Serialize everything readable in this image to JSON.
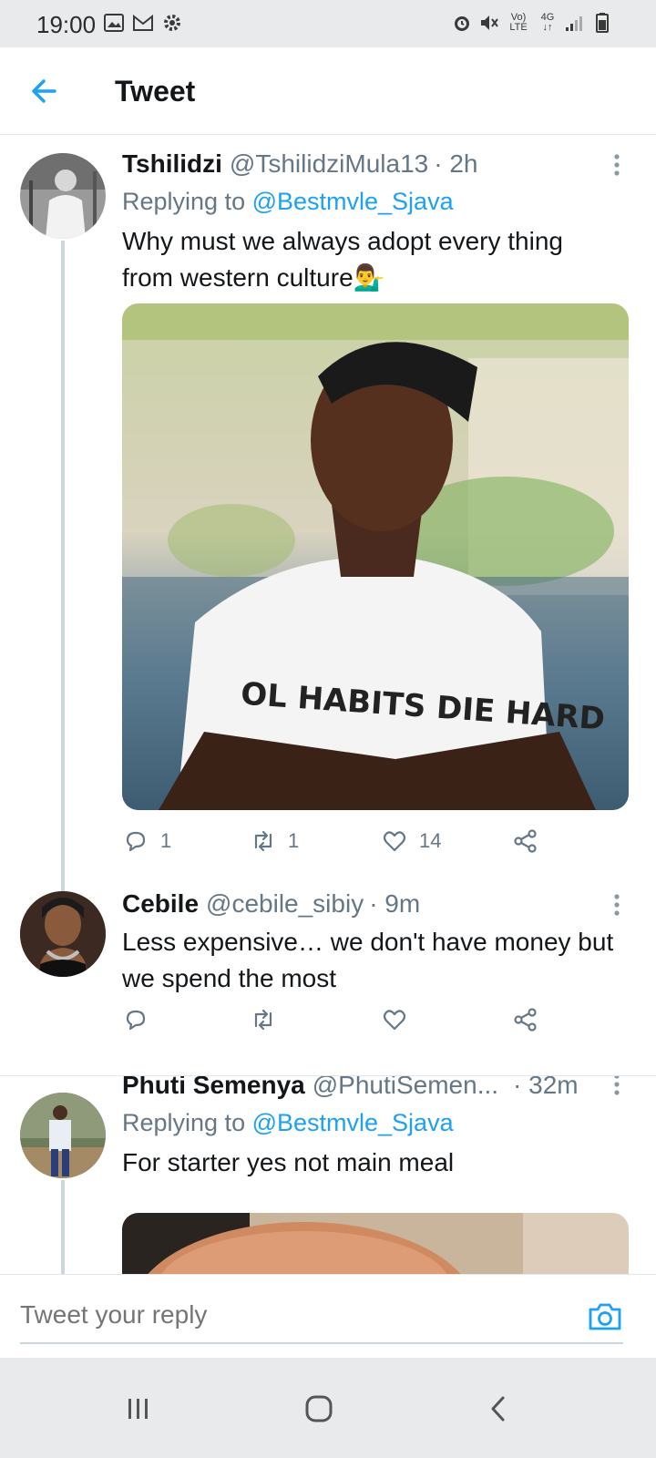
{
  "status_bar": {
    "time": "19:00",
    "left_icons": [
      "image-icon",
      "gmail-icon",
      "gear-icon"
    ],
    "right_icons": [
      "alarm-icon",
      "mute-icon",
      "volte-icon",
      "network-4g-icon",
      "signal-icon",
      "battery-icon"
    ],
    "volte_label_top": "Vo)",
    "volte_label_bottom": "LTE",
    "net_label": "4G"
  },
  "header": {
    "title": "Tweet"
  },
  "tweets": [
    {
      "name": "Tshilidzi",
      "handle": "@TshilidziMula13",
      "time": "· 2h",
      "replying_prefix": "Replying to ",
      "replying_to": "@Bestmvle_Sjava",
      "text": "Why must we always adopt every thing from western culture💁‍♂️",
      "image_shirt_text": "OL HABITS DIE HARD",
      "replies": "1",
      "retweets": "1",
      "likes": "14"
    },
    {
      "name": "Cebile",
      "handle": "@cebile_sibiy",
      "time": "· 9m",
      "text": "Less expensive… we don't have money but we spend the most",
      "replies": "",
      "retweets": "",
      "likes": ""
    },
    {
      "name": "Phuti Semenya",
      "handle": "@PhutiSemen...",
      "time": "· 32m",
      "replying_prefix": "Replying to ",
      "replying_to": "@Bestmvle_Sjava",
      "text": "For starter yes not main meal"
    }
  ],
  "composer": {
    "placeholder": "Tweet your reply"
  },
  "colors": {
    "accent": "#1da1f2",
    "secondary_text": "#657786",
    "divider": "#e1e8ed"
  }
}
